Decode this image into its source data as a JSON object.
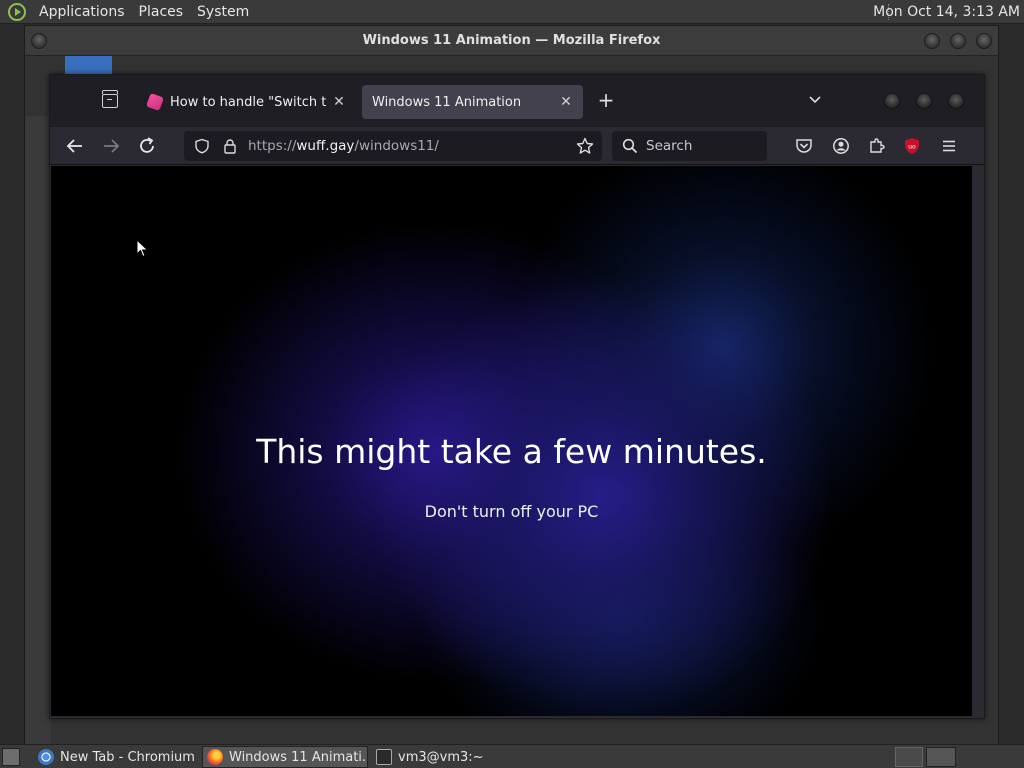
{
  "top_panel": {
    "menus": [
      "Applications",
      "Places",
      "System"
    ],
    "clock": "Mon Oct 14,  3:13 AM"
  },
  "outer_window": {
    "title": "Windows 11 Animation — Mozilla Firefox"
  },
  "firefox": {
    "tabs": [
      {
        "label": "How to handle \"Switch to a",
        "active": false
      },
      {
        "label": "Windows 11 Animation",
        "active": true
      }
    ],
    "url": {
      "scheme": "https://",
      "host": "wuff.gay",
      "path": "/windows11/"
    },
    "search_placeholder": "Search",
    "page": {
      "headline": "This might take a few minutes.",
      "subline": "Don't turn off your PC"
    }
  },
  "taskbar": {
    "items": [
      {
        "label": "New Tab - Chromium",
        "icon": "chromium-icon"
      },
      {
        "label": "Windows 11 Animati...",
        "icon": "firefox-icon",
        "active": true
      },
      {
        "label": "vm3@vm3:~",
        "icon": "terminal-icon"
      }
    ]
  },
  "colors": {
    "accent_pink": "#ff4fa0",
    "ublock_red": "#c8102e"
  }
}
